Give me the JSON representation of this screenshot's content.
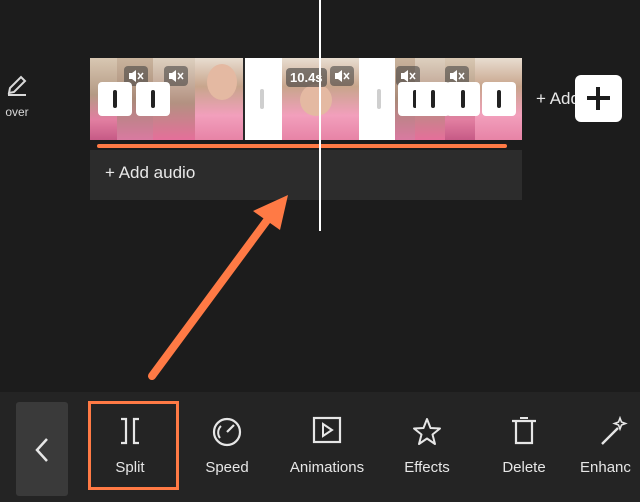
{
  "cover": {
    "label": "over",
    "icon": "pencil-icon"
  },
  "timeline": {
    "clip_duration": "10.4s",
    "add_clip_label": "+ Add di",
    "add_audio_label": "+  Add audio"
  },
  "toolbar": {
    "back_icon": "chevron-left-icon",
    "items": [
      {
        "label": "Split",
        "icon": "split-icon"
      },
      {
        "label": "Speed",
        "icon": "speedometer-icon"
      },
      {
        "label": "Animations",
        "icon": "play-square-icon"
      },
      {
        "label": "Effects",
        "icon": "sparkle-star-icon"
      },
      {
        "label": "Delete",
        "icon": "trash-icon"
      },
      {
        "label": "Enhanc",
        "icon": "magic-wand-icon"
      }
    ]
  },
  "colors": {
    "accent": "#ff7a45",
    "background": "#1c1c1c",
    "toolbar": "#242424"
  }
}
